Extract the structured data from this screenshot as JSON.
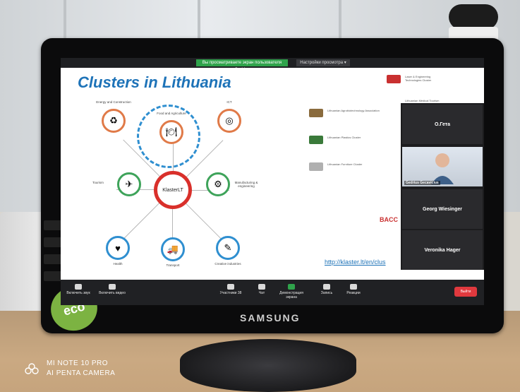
{
  "slide": {
    "title": "Clusters in Lithuania",
    "center_label": "KlasterLT",
    "url": "http://klaster.lt/en/clus",
    "nodes": [
      {
        "label": "Energy and Construction",
        "glyph": "♻"
      },
      {
        "label": "Food and Agriculture",
        "glyph": "🍽"
      },
      {
        "label": "ICT",
        "glyph": "◎"
      },
      {
        "label": "Tourism",
        "glyph": "✈"
      },
      {
        "label": "Manufacturing & engineering",
        "glyph": "⚙"
      },
      {
        "label": "Health",
        "glyph": "♥"
      },
      {
        "label": "Transport",
        "glyph": "🚚"
      },
      {
        "label": "Creative industries",
        "glyph": "✎"
      }
    ],
    "right_entries": [
      {
        "name": "Lithuanian Agrobiotechnology Association",
        "logo_color": "#8a6b3d"
      },
      {
        "name": "Lithuanian Plastics Cluster",
        "logo_color": "#3a7a3a"
      },
      {
        "name": "Lithuanian Furniture Cluster",
        "logo_color": "#b0b0b0"
      },
      {
        "name": "Laser & Engineering Technologies Cluster",
        "logo_color": "#c93030"
      },
      {
        "name": "Lithuanian Medical Tourism Cluster",
        "logo_color": "#2f7a4a"
      },
      {
        "name": "BACC",
        "logo_color": "#c93030"
      }
    ]
  },
  "zoom": {
    "share_banner": "Вы просматриваете экран пользователя Gedrius",
    "view_options": "Настройки просмотра ▾",
    "toolbar": {
      "unmute": "Включить звук",
      "start_video": "Включить видео",
      "participants": "Участники",
      "participants_count": "38",
      "chat": "Чат",
      "share_screen": "Демонстрация экрана",
      "record": "Запись",
      "reactions": "Реакции",
      "leave": "Выйти"
    },
    "participants_panel": [
      {
        "name": "O.Гета",
        "has_video": false
      },
      {
        "name": "Gedrius Gecavicius",
        "has_video": true
      },
      {
        "name": "Georg Wiesinger",
        "has_video": false
      },
      {
        "name": "Veronika Hager",
        "has_video": false
      }
    ]
  },
  "monitor": {
    "brand": "SAMSUNG",
    "eco_sticker": "eco"
  },
  "camera_watermark": {
    "line1": "MI NOTE 10 PRO",
    "line2": "AI PENTA CAMERA"
  },
  "colors": {
    "accent_blue": "#1e73b8",
    "accent_red": "#d9302b",
    "zoom_green": "#2fa34b",
    "leave_red": "#e0393e"
  }
}
